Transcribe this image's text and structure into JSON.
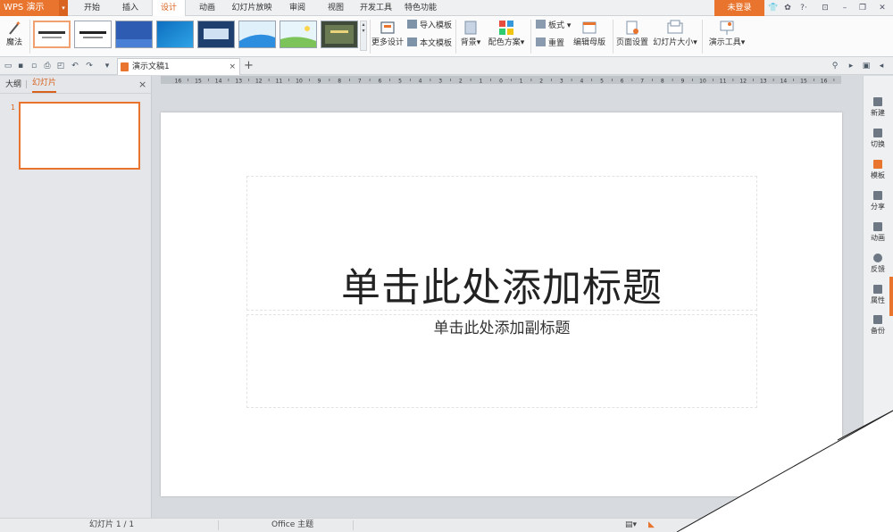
{
  "app": {
    "name": "WPS 演示",
    "login": "未登录"
  },
  "menu": {
    "tabs": [
      "开始",
      "插入",
      "设计",
      "动画",
      "幻灯片放映",
      "审阅",
      "视图",
      "开发工具",
      "特色功能"
    ],
    "active": "设计"
  },
  "ribbon": {
    "magic": "魔法",
    "more_design": "更多设计",
    "import_template": "导入模板",
    "this_template": "本文模板",
    "background": "背景",
    "color_scheme": "配色方案",
    "layout": "板式",
    "reset": "重置",
    "edit_master": "编辑母版",
    "page_setup": "页面设置",
    "slide_size": "幻灯片大小",
    "present_tools": "演示工具"
  },
  "doc": {
    "tab_title": "演示文稿1",
    "close": "×",
    "new_tab": "+"
  },
  "left_panel": {
    "outline": "大纲",
    "slides": "幻灯片",
    "close": "×",
    "slide_number": "1"
  },
  "slide": {
    "title": "单击此处添加标题",
    "subtitle": "单击此处添加副标题"
  },
  "right_rail": [
    "新建",
    "切换",
    "模板",
    "分享",
    "动画",
    "反馈",
    "属性",
    "备份"
  ],
  "status": {
    "slide_info": "幻灯片 1 / 1",
    "theme": "Office 主题"
  },
  "colors": {
    "accent": "#e8742e",
    "accent_dark": "#d8611e"
  }
}
